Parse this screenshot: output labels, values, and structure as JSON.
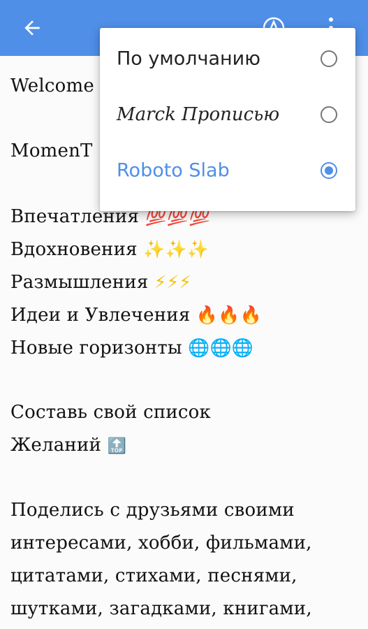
{
  "appbar": {
    "color": "#4f8fe8",
    "back_icon": "arrow-back-icon",
    "font_icon": "font-style-icon",
    "more_icon": "more-vert-icon"
  },
  "content": {
    "welcome": "Welcome",
    "momentum": "MomenT",
    "line_impressions": "Впечатления",
    "emoji_impressions": "💯💯💯",
    "line_inspiration": "Вдохновения",
    "emoji_inspiration": "✨✨✨",
    "line_reflections": "Размышления",
    "emoji_reflections": "⚡⚡⚡",
    "line_ideas": "Идеи и Увлечения",
    "emoji_ideas": "🔥🔥🔥",
    "line_horizons": "Новые горизонты",
    "emoji_horizons": "🌐🌐🌐",
    "line_make_list": "Составь свой список",
    "line_wishes": "Желаний",
    "emoji_top": "🔝",
    "share_1": "Поделись с друзьями своими",
    "share_2": "интересами, хобби, фильмами,",
    "share_3": "цитатами, стихами, песнями,",
    "share_4": "шутками, загадками, книгами,"
  },
  "menu": {
    "items": [
      {
        "label": "По умолчанию",
        "selected": false
      },
      {
        "label": "Marck Прописью",
        "selected": false
      },
      {
        "label": "Roboto Slab",
        "selected": true
      }
    ],
    "accent": "#4f8fe8"
  }
}
